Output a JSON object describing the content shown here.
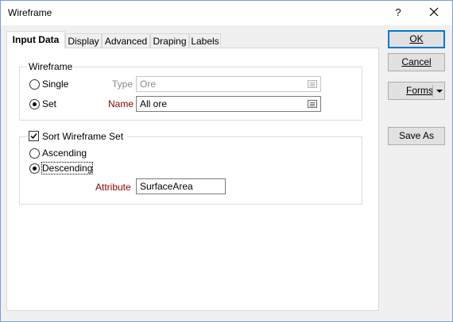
{
  "window": {
    "title": "Wireframe",
    "help_label": "?"
  },
  "tabs": [
    {
      "label": "Input Data",
      "active": true
    },
    {
      "label": "Display",
      "active": false
    },
    {
      "label": "Advanced",
      "active": false
    },
    {
      "label": "Draping",
      "active": false
    },
    {
      "label": "Labels",
      "active": false
    }
  ],
  "wireframe_group": {
    "legend": "Wireframe",
    "single_label": "Single",
    "set_label": "Set",
    "selected": "Set",
    "type_label": "Type",
    "type_value": "Ore",
    "name_label": "Name",
    "name_value": "All ore"
  },
  "sort_group": {
    "legend": "Sort Wireframe Set",
    "checked": true,
    "ascending_label": "Ascending",
    "descending_label": "Descending",
    "selected": "Descending",
    "attribute_label": "Attribute",
    "attribute_value": "SurfaceArea"
  },
  "buttons": {
    "ok": "OK",
    "cancel": "Cancel",
    "forms": "Forms",
    "save_as": "Save As"
  },
  "colors": {
    "accent": "#0078d7",
    "required_label": "#8b0000",
    "window_border": "#6f9fd8"
  }
}
